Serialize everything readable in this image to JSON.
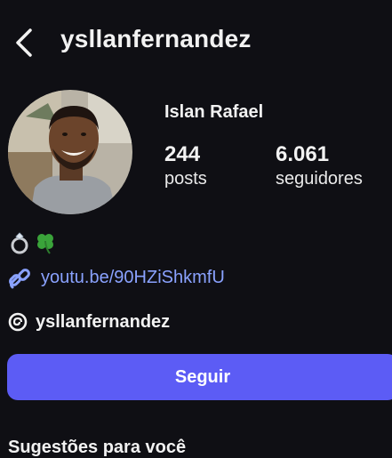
{
  "header": {
    "username": "ysllanfernandez",
    "back_icon": "chevron-left-icon"
  },
  "profile": {
    "display_name": "Islan Rafael",
    "stats": {
      "posts_count": "244",
      "posts_label": "posts",
      "followers_count": "6.061",
      "followers_label": "seguidores"
    },
    "bio_emojis": [
      "ring-icon",
      "four-leaf-clover-icon"
    ],
    "link": {
      "icon": "link-icon",
      "text": "youtu.be/90HZiShkmfU"
    },
    "threads": {
      "icon": "threads-icon",
      "handle": "ysllanfernandez"
    },
    "follow_button_label": "Seguir"
  },
  "suggestions": {
    "title": "Sugestões para você"
  },
  "colors": {
    "background": "#0f0f14",
    "accent": "#5c5cf5",
    "link": "#8aa2ff"
  }
}
